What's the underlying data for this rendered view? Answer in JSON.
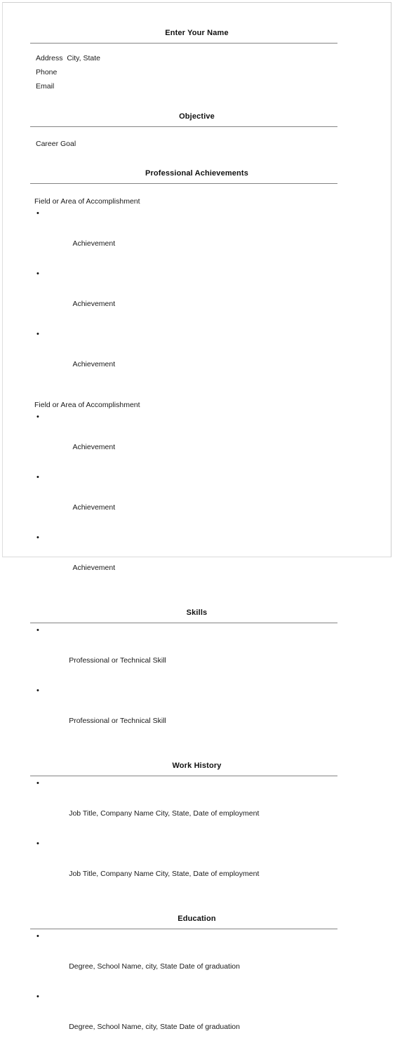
{
  "document": {
    "type": "resume-template",
    "bullet_glyph": "•",
    "rule_color": "#848484",
    "page_border_color": "#d4d4d4",
    "text_color": "#1a1a1a"
  },
  "sections": {
    "name": {
      "heading": "Enter Your Name",
      "lines": [
        "Address  City, State",
        "Phone",
        "Email"
      ]
    },
    "objective": {
      "heading": "Objective",
      "lines": [
        "Career Goal"
      ]
    },
    "achievements": {
      "heading": "Professional Achievements",
      "groups": [
        {
          "title": "Field or Area of Accomplishment",
          "items": [
            "Achievement",
            "Achievement",
            "Achievement"
          ]
        },
        {
          "title": "Field or Area of Accomplishment",
          "items": [
            "Achievement",
            "Achievement",
            "Achievement"
          ]
        }
      ]
    },
    "skills": {
      "heading": "Skills",
      "items": [
        "Professional or Technical Skill",
        "Professional or Technical Skill"
      ]
    },
    "work_history": {
      "heading": "Work History",
      "items": [
        "Job Title, Company Name City, State, Date of employment",
        "Job Title, Company Name City, State, Date of employment"
      ]
    },
    "education": {
      "heading": "Education",
      "items": [
        "Degree, School Name, city, State Date of graduation",
        "Degree, School Name, city, State Date of graduation"
      ]
    }
  }
}
